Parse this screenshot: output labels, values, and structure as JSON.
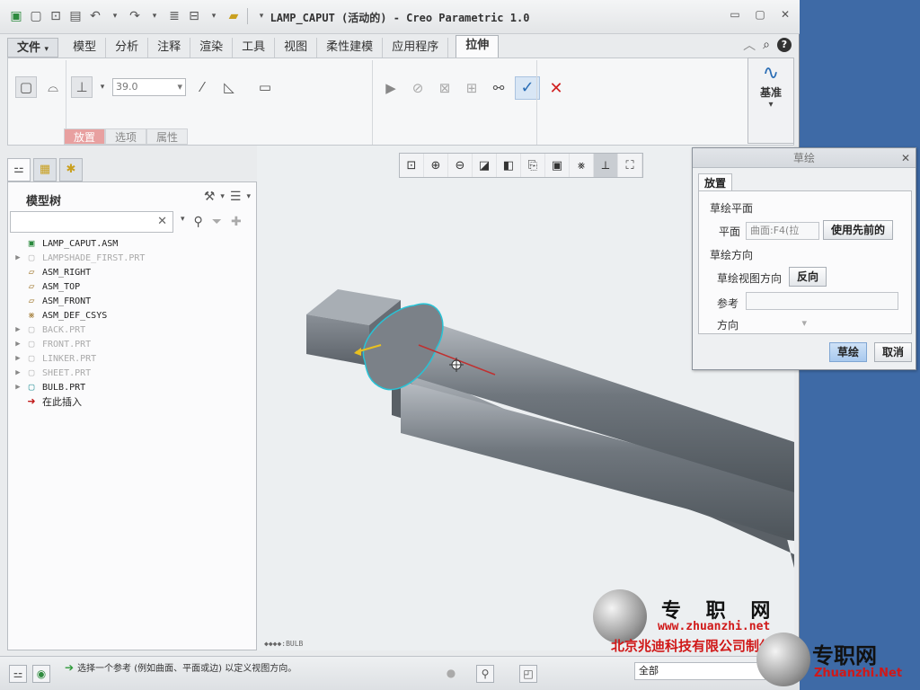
{
  "titlebar": {
    "title": "LAMP_CAPUT (活动的) - Creo Parametric 1.0"
  },
  "ribbon": {
    "file_tab": "文件",
    "tabs": [
      "模型",
      "分析",
      "注释",
      "渲染",
      "工具",
      "视图",
      "柔性建模",
      "应用程序"
    ],
    "active_tab": "拉伸",
    "depth_value": "39.0",
    "subtabs": [
      "放置",
      "选项",
      "属性"
    ],
    "datum_label": "基准"
  },
  "model_tree": {
    "title": "模型树",
    "search_placeholder": "",
    "nodes": [
      {
        "label": "LAMP_CAPUT.ASM",
        "icon": "assembly-icon",
        "expandable": false,
        "dim": false
      },
      {
        "label": "LAMPSHADE_FIRST.PRT",
        "icon": "part-icon",
        "expandable": true,
        "dim": true
      },
      {
        "label": "ASM_RIGHT",
        "icon": "datum-plane-icon",
        "expandable": false,
        "dim": false
      },
      {
        "label": "ASM_TOP",
        "icon": "datum-plane-icon",
        "expandable": false,
        "dim": false
      },
      {
        "label": "ASM_FRONT",
        "icon": "datum-plane-icon",
        "expandable": false,
        "dim": false
      },
      {
        "label": "ASM_DEF_CSYS",
        "icon": "csys-icon",
        "expandable": false,
        "dim": false
      },
      {
        "label": "BACK.PRT",
        "icon": "part-icon",
        "expandable": true,
        "dim": true
      },
      {
        "label": "FRONT.PRT",
        "icon": "part-icon",
        "expandable": true,
        "dim": true
      },
      {
        "label": "LINKER.PRT",
        "icon": "part-icon",
        "expandable": true,
        "dim": true
      },
      {
        "label": "SHEET.PRT",
        "icon": "part-icon",
        "expandable": true,
        "dim": true
      },
      {
        "label": "BULB.PRT",
        "icon": "part-active-icon",
        "expandable": true,
        "dim": false
      },
      {
        "label": "在此插入",
        "icon": "insert-here-icon",
        "expandable": false,
        "dim": false
      }
    ]
  },
  "graphics": {
    "part_label": "BULB"
  },
  "sketch_dialog": {
    "title": "草绘",
    "tab": "放置",
    "section_plane": "草绘平面",
    "plane_label": "平面",
    "plane_value": "曲面:F4(拉",
    "use_previous": "使用先前的",
    "section_orientation": "草绘方向",
    "view_direction_label": "草绘视图方向",
    "flip_button": "反向",
    "reference_label": "参考",
    "reference_value": "",
    "orientation_label": "方向",
    "orientation_value": "",
    "ok_button": "草绘",
    "cancel_button": "取消"
  },
  "statusbar": {
    "message": "选择一个参考 (例如曲面、平面或边) 以定义视图方向。",
    "filter_value": "全部"
  },
  "watermark": {
    "brand_cn": "专 职 网",
    "url": "www.zhuanzhi.net",
    "company": "北京兆迪科技有限公司制作",
    "brand_cn2": "专职网",
    "url2": "Zhuanzhi.Net"
  },
  "colors": {
    "desktop": "#3e6aa6",
    "accent_blue": "#2a6db5",
    "highlight_cyan": "#27c3d6",
    "cancel_red": "#d02020"
  }
}
